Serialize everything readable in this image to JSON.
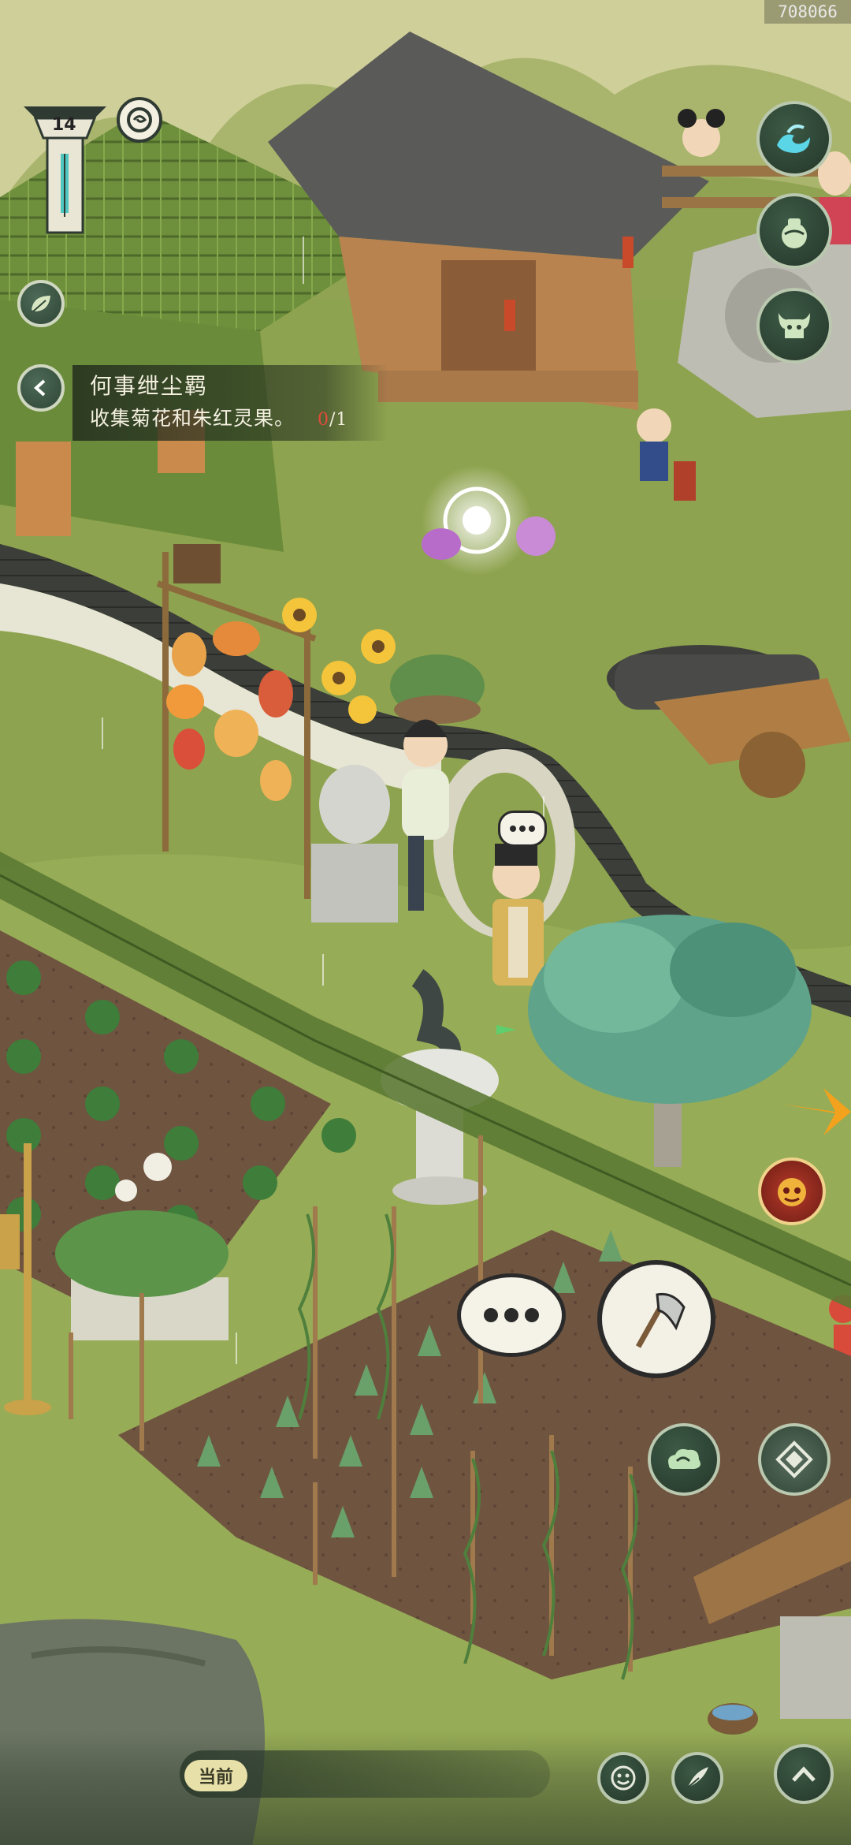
{
  "status": {
    "id_code": "708066"
  },
  "hud": {
    "level": "14"
  },
  "quest": {
    "title": "何事绁尘羁",
    "description": "收集菊花和朱红灵果。",
    "progress_current": "0",
    "progress_total": "/1"
  },
  "chat": {
    "channel_label": "当前"
  },
  "colors": {
    "grass": "#8ea34f",
    "ui_button": "#2f4535",
    "quest_bg": "#232d1e",
    "progress_red": "#e24a3a"
  },
  "icons": {
    "right_buttons": [
      "wave-skill-icon",
      "gourd-icon",
      "bull-mask-icon"
    ],
    "left_buttons": [
      "leaf-icon",
      "back-arrow-icon"
    ],
    "actions": [
      "axe-icon",
      "talk-bubble-icon",
      "cloud-icon",
      "compass-icon",
      "face-icon",
      "feather-icon",
      "chevron-up-icon"
    ]
  }
}
